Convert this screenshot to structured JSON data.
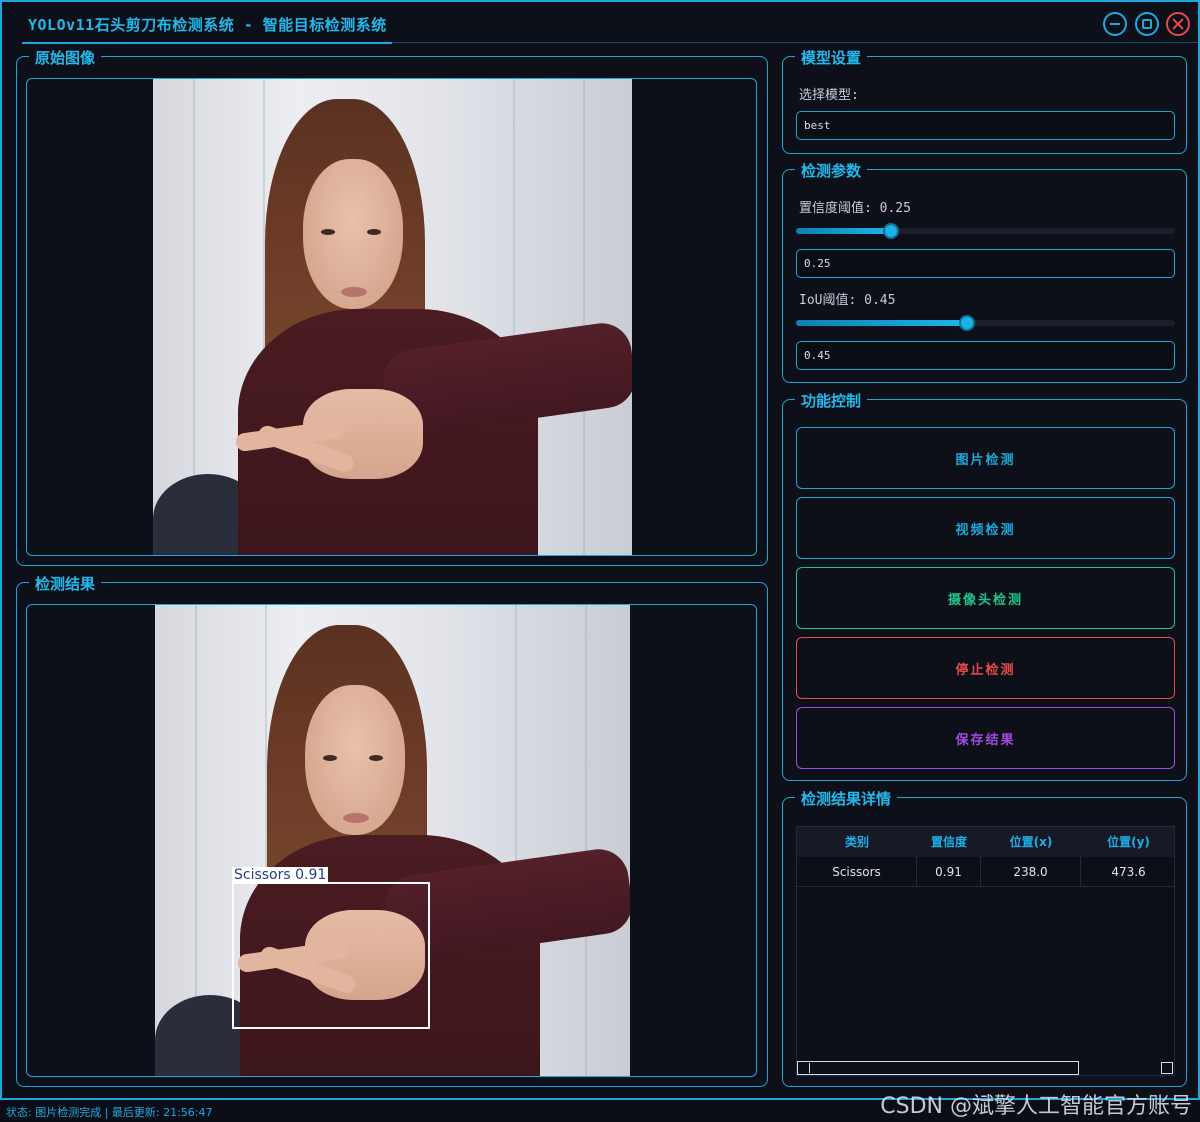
{
  "window": {
    "title": "YOLOv11石头剪刀布检测系统 - 智能目标检测系统",
    "accent": "#1ea7d8"
  },
  "original_panel": {
    "title": "原始图像"
  },
  "result_panel": {
    "title": "检测结果",
    "detection_label": "Scissors 0.91"
  },
  "model": {
    "title": "模型设置",
    "select_label": "选择模型:",
    "selected": "best"
  },
  "params": {
    "title": "检测参数",
    "conf_label": "置信度阈值: 0.25",
    "conf_value": "0.25",
    "conf_fraction": 0.25,
    "iou_label": "IoU阈值: 0.45",
    "iou_value": "0.45",
    "iou_fraction": 0.45
  },
  "controls": {
    "title": "功能控制",
    "image_detect": "图片检测",
    "video_detect": "视频检测",
    "camera_detect": "摄像头检测",
    "stop_detect": "停止检测",
    "save_results": "保存结果",
    "colors": {
      "image": "#1ea7d8",
      "video": "#1ea7d8",
      "camera": "#22c48a",
      "stop": "#e84a4a",
      "save": "#a24be0"
    }
  },
  "details": {
    "title": "检测结果详情",
    "columns": [
      "类别",
      "置信度",
      "位置(x)",
      "位置(y)"
    ],
    "rows": [
      {
        "class": "Scissors",
        "confidence": "0.91",
        "x": "238.0",
        "y": "473.6"
      }
    ]
  },
  "status": {
    "text": "状态: 图片检测完成 | 最后更新: 21:56:47",
    "watermark": "CSDN @斌擎人工智能官方账号"
  }
}
